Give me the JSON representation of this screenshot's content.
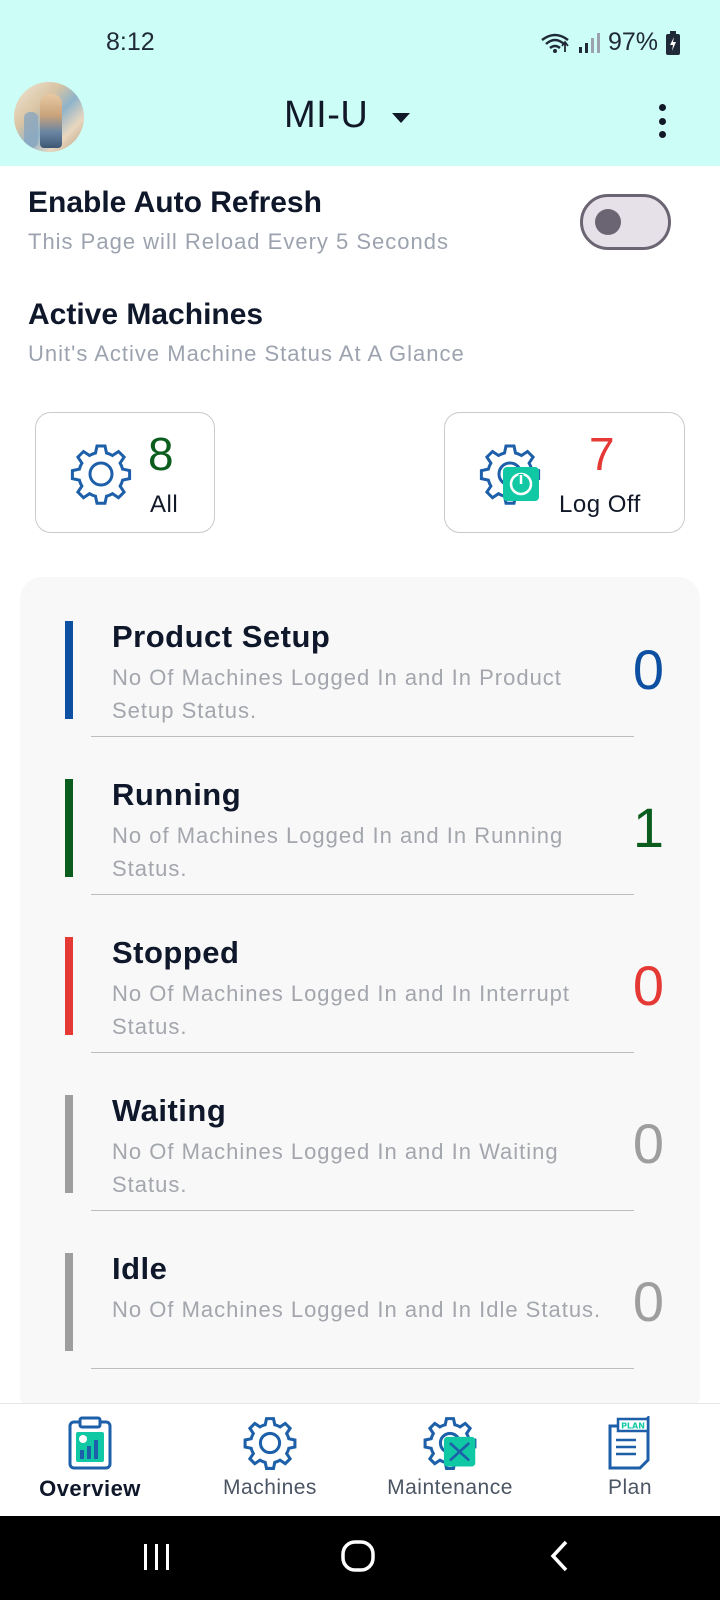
{
  "status_bar": {
    "time": "8:12",
    "battery": "97%"
  },
  "header": {
    "unit": "MI-U"
  },
  "auto_refresh": {
    "title": "Enable Auto Refresh",
    "subtitle": "This Page will Reload Every 5 Seconds",
    "enabled": false
  },
  "active_machines": {
    "title": "Active Machines",
    "subtitle": "Unit's Active Machine Status At A Glance"
  },
  "summary": {
    "all": {
      "count": "8",
      "label": "All",
      "color": "#0b5d1e"
    },
    "log_off": {
      "count": "7",
      "label": "Log Off",
      "color": "#e53935"
    }
  },
  "statuses": [
    {
      "title": "Product Setup",
      "desc": "No Of Machines Logged In and In Product Setup Status.",
      "count": "0",
      "color": "#0d4fa0"
    },
    {
      "title": "Running",
      "desc": "No of Machines Logged In and In Running Status.",
      "count": "1",
      "color": "#0b5d1e"
    },
    {
      "title": "Stopped",
      "desc": "No Of Machines Logged In and In Interrupt Status.",
      "count": "0",
      "color": "#e53935"
    },
    {
      "title": "Waiting",
      "desc": "No Of Machines Logged In and In Waiting Status.",
      "count": "0",
      "color": "#9e9e9e"
    },
    {
      "title": "Idle",
      "desc": "No Of Machines Logged In and In Idle Status.",
      "count": "0",
      "color": "#9e9e9e"
    }
  ],
  "nav": {
    "items": [
      {
        "label": "Overview",
        "icon": "clipboard-chart-icon",
        "active": true
      },
      {
        "label": "Machines",
        "icon": "gear-icon",
        "active": false
      },
      {
        "label": "Maintenance",
        "icon": "gear-wrench-icon",
        "active": false
      },
      {
        "label": "Plan",
        "icon": "plan-document-icon",
        "active": false
      }
    ]
  },
  "colors": {
    "header_bg": "#ccfdf6",
    "accent_teal": "#10c9a4",
    "icon_blue": "#1d5fa8"
  }
}
